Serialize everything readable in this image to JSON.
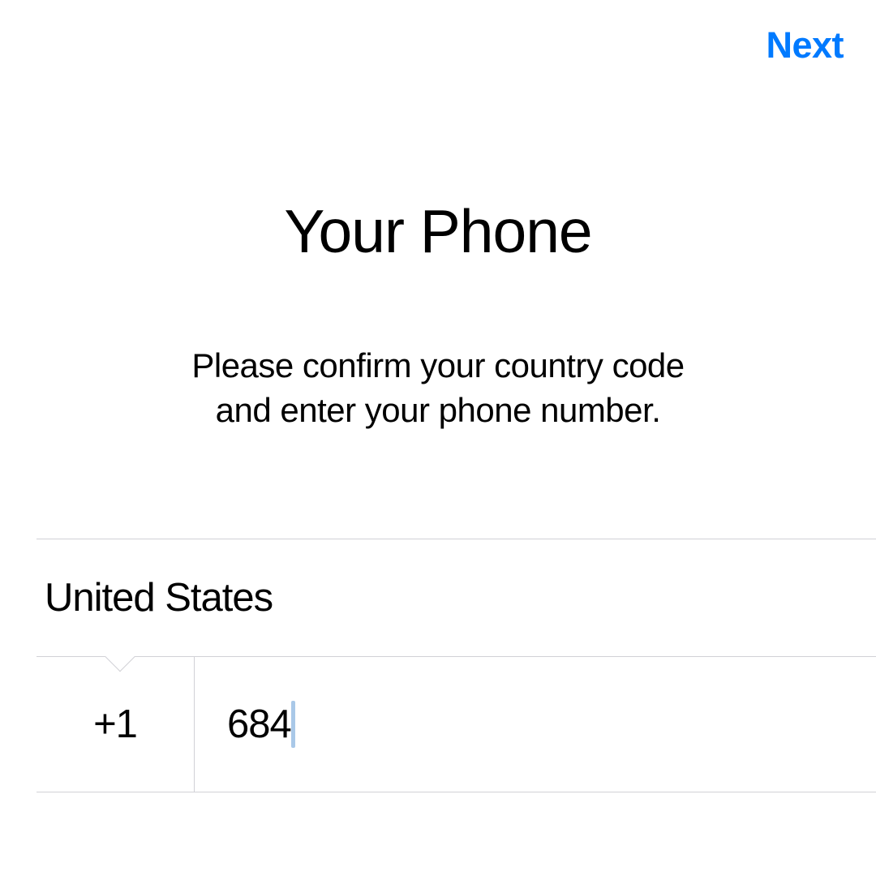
{
  "header": {
    "next_label": "Next"
  },
  "title": "Your Phone",
  "subtitle_line1": "Please confirm your country code",
  "subtitle_line2": "and enter your phone number.",
  "form": {
    "country": "United States",
    "country_code": "+1",
    "phone_value": "684"
  },
  "colors": {
    "accent": "#007aff",
    "divider": "#d1d1d6"
  }
}
